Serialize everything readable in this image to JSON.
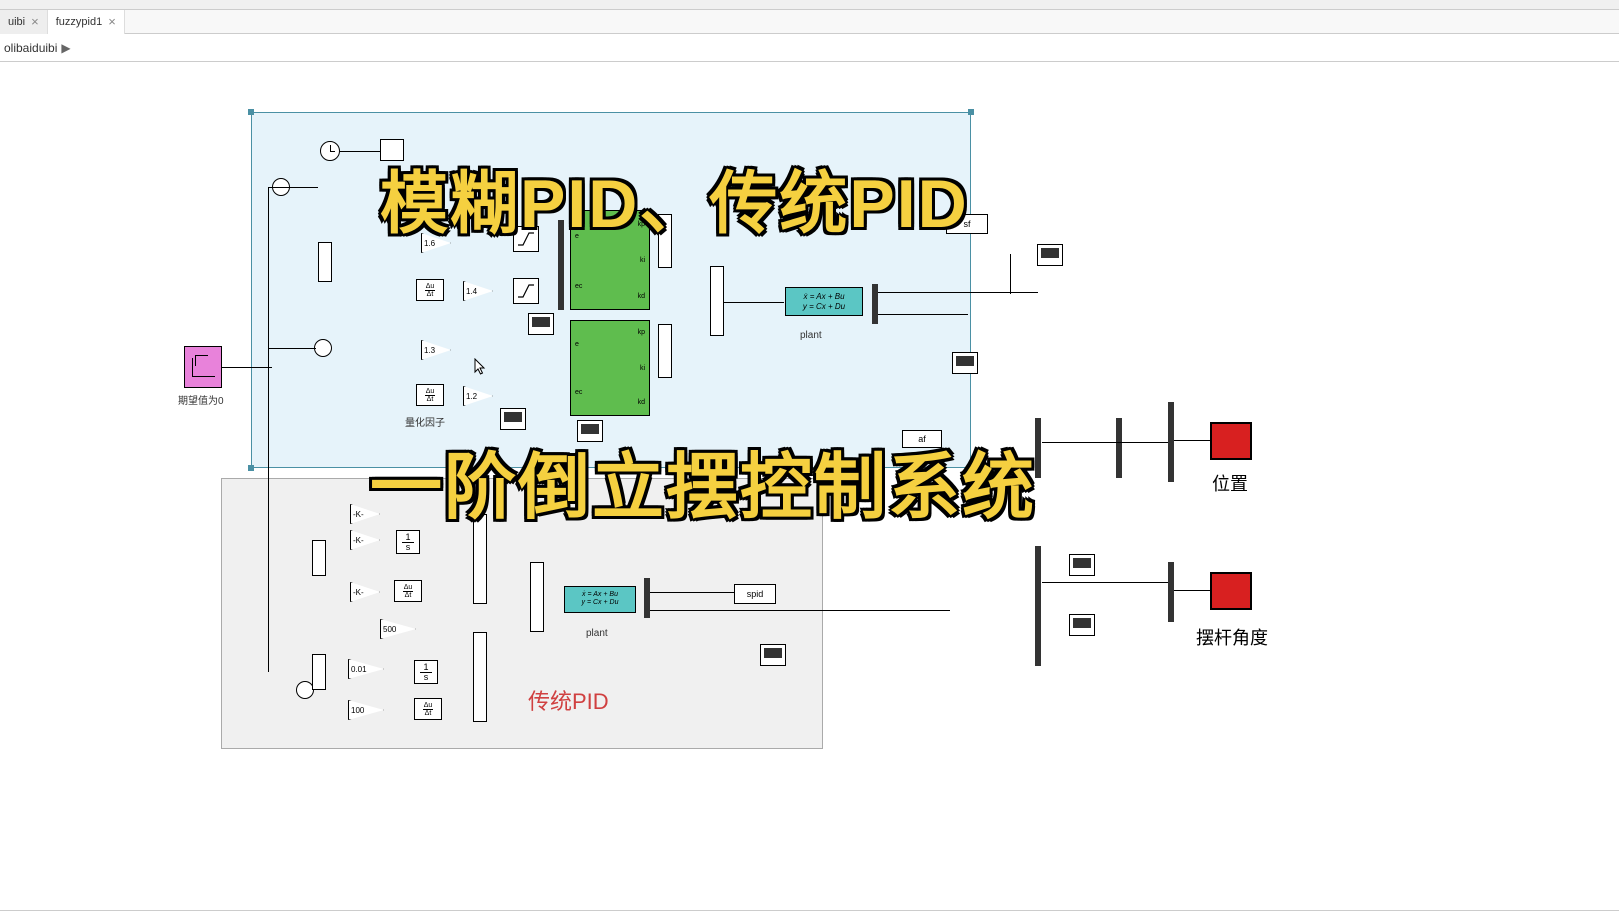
{
  "tabs": [
    {
      "label": "uibi"
    },
    {
      "label": "fuzzypid1"
    }
  ],
  "breadcrumb": "olibaiduibi",
  "overlay": {
    "title1": "模糊PID、传统PID",
    "title2": "一阶倒立摆控制系统"
  },
  "source": {
    "step_label": "期望值为0"
  },
  "fuzzy_group": {
    "gains": {
      "g1": "1.6",
      "g2": "1.4",
      "g3": "1.3",
      "g4": "1.2"
    },
    "quant_label": "量化因子",
    "fuzzy1": {
      "in1": "e",
      "in2": "ec",
      "out1": "kp",
      "out2": "ki",
      "out3": "kd"
    },
    "fuzzy2": {
      "in1": "e",
      "in2": "ec",
      "out1": "kp",
      "out2": "ki",
      "out3": "kd"
    },
    "ss": {
      "eq1": "ẋ = Ax + Bu",
      "eq2": "y = Cx + Du",
      "label": "plant"
    },
    "sf_label": "sf",
    "af_label": "af"
  },
  "pid_group": {
    "title": "传统PID",
    "gains": {
      "k1": "-K-",
      "k2": "-K-",
      "k3": "-K-",
      "k4": "500",
      "k5": "0.01",
      "k6": "100"
    },
    "ss": {
      "eq1": "ẋ = Ax + Bu",
      "eq2": "y = Cx + Du",
      "label": "plant"
    },
    "spid_label": "spid"
  },
  "integrator": {
    "num": "1",
    "den": "s"
  },
  "derivative": {
    "num": "Δu",
    "den": "Δt"
  },
  "outputs": {
    "pos_label": "位置",
    "angle_label": "摆杆角度"
  }
}
